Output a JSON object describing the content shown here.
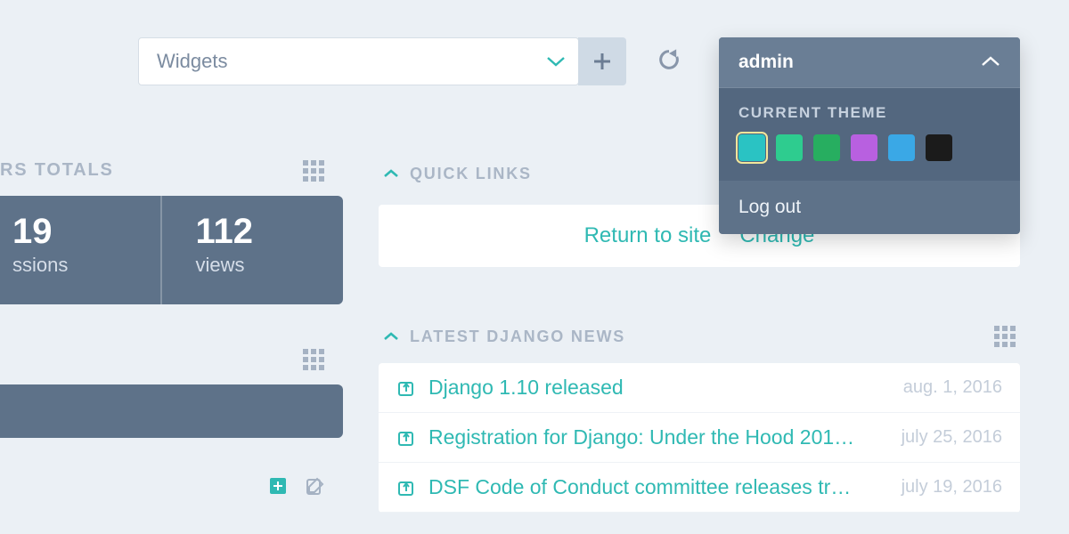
{
  "toolbar": {
    "widgets_label": "Widgets"
  },
  "user_panel": {
    "username": "admin",
    "theme_label": "CURRENT THEME",
    "logout_label": "Log out",
    "swatches": [
      "#2ac3c3",
      "#2ecc8f",
      "#27ae60",
      "#b860e0",
      "#3aa8e6",
      "#1b1b1b"
    ],
    "active_swatch_index": 0
  },
  "totals": {
    "section_label": "RS TOTALS",
    "col1_value": "19",
    "col1_label": "ssions",
    "col2_value": "112",
    "col2_label": "views"
  },
  "quick_links": {
    "header": "QUICK LINKS",
    "items": [
      "Return to site",
      "Change"
    ]
  },
  "news": {
    "header": "LATEST DJANGO NEWS",
    "rows": [
      {
        "title": "Django 1.10 released",
        "date": "aug. 1, 2016"
      },
      {
        "title": "Registration for Django: Under the Hood 201…",
        "date": "july 25, 2016"
      },
      {
        "title": "DSF Code of Conduct committee releases tr…",
        "date": "july 19, 2016"
      }
    ]
  }
}
